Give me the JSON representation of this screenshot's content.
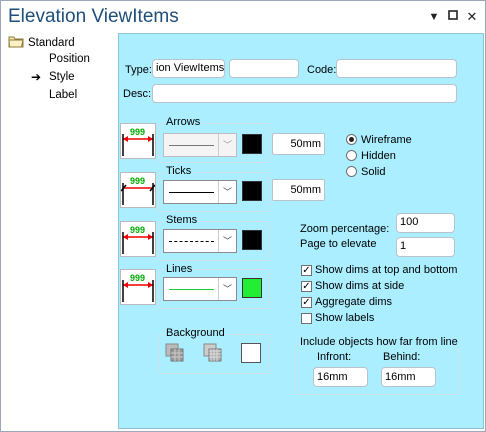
{
  "window": {
    "title": "Elevation ViewItems"
  },
  "tree": {
    "root": "Standard",
    "items": [
      "Position",
      "Style",
      "Label"
    ]
  },
  "form": {
    "type_label": "Type:",
    "type_value": "ion ViewItems",
    "type_value2": "",
    "code_label": "Code:",
    "code_value": "",
    "desc_label": "Desc:",
    "desc_value": ""
  },
  "arrows": {
    "title": "Arrows",
    "size": "50mm",
    "preview_text": "999",
    "color": "#000000"
  },
  "ticks": {
    "title": "Ticks",
    "size": "50mm",
    "preview_text": "999",
    "color": "#000000"
  },
  "stems": {
    "title": "Stems",
    "preview_text": "999",
    "color": "#000000"
  },
  "lines": {
    "title": "Lines",
    "preview_text": "999",
    "color": "#22dd33"
  },
  "background": {
    "title": "Background",
    "color": "#ffffff"
  },
  "view_mode": {
    "options": [
      "Wireframe",
      "Hidden",
      "Solid"
    ],
    "selected": "Wireframe"
  },
  "zoom": {
    "label": "Zoom percentage:",
    "value": "100"
  },
  "page": {
    "label": "Page to elevate",
    "value": "1"
  },
  "checks": [
    {
      "label": "Show dims at top and bottom",
      "checked": true
    },
    {
      "label": "Show dims at side",
      "checked": true
    },
    {
      "label": "Aggregate dims",
      "checked": true
    },
    {
      "label": "Show labels",
      "checked": false
    }
  ],
  "include": {
    "title": "Include objects how far from line",
    "infront_label": "Infront:",
    "infront_value": "16mm",
    "behind_label": "Behind:",
    "behind_value": "16mm"
  }
}
